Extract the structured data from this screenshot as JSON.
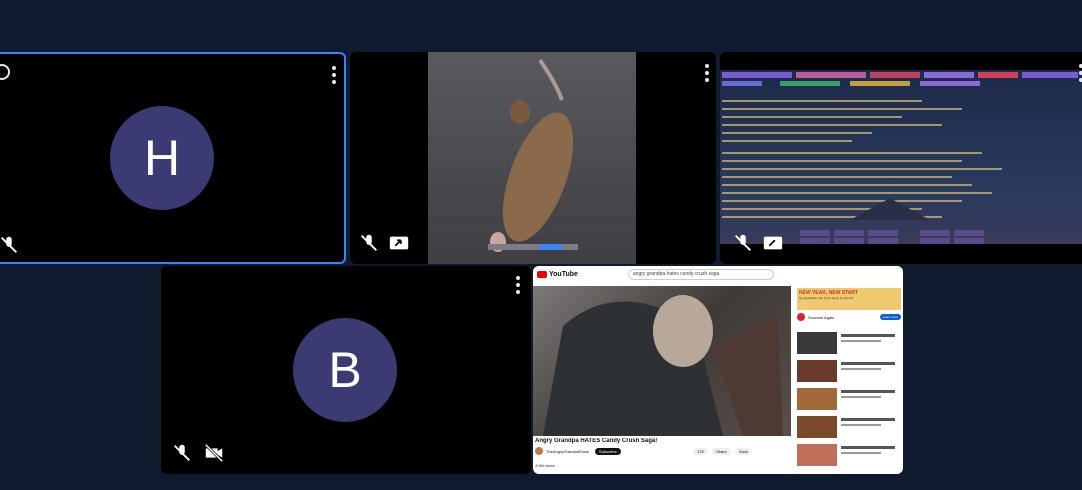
{
  "participants": [
    {
      "initial": "H"
    },
    {
      "initial": "B"
    }
  ],
  "screens": {
    "rat_video": {
      "caption": ""
    },
    "terminal": {
      "tabs": [
        "",
        "",
        "",
        "",
        "",
        "",
        ""
      ]
    },
    "youtube": {
      "logo": "YouTube",
      "search": "angry grandpa hates candy crush saga",
      "video_title": "Angry Grandpa HATES Candy Crush Saga!",
      "channel": "TheAngryGrandpaShow",
      "subscribe": "Subscribe",
      "ad_banner": "NEW YEAR, NEW START",
      "ad_sub": "No application fee if you apply by Jan 15",
      "ad_title": "Success Again",
      "ad_button": "Learn more",
      "likes": "17K",
      "share": "Share",
      "save": "Save",
      "views": "4.6M views"
    }
  },
  "colors": {
    "background": "#0f1a2e",
    "tile": "#000000",
    "active_border": "#3b82f6",
    "avatar": "#3b3a72"
  }
}
